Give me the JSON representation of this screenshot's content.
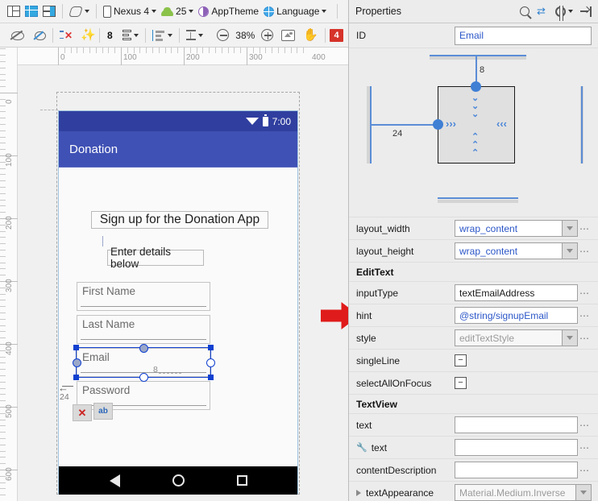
{
  "toolbar_top": {
    "items": [
      {
        "name": "design-view-button",
        "icon": "layout-design-icon",
        "label": ""
      },
      {
        "name": "blueprint-view-button",
        "icon": "blueprint-icon",
        "label": ""
      },
      {
        "name": "design-blueprint-split-button",
        "icon": "design-blueprint-icon",
        "label": ""
      },
      {
        "name": "orientation-button",
        "icon": "orientation-icon",
        "label": "",
        "has_caret": true
      },
      {
        "name": "device-selector",
        "icon": "phone-icon",
        "label": "Nexus 4",
        "has_caret": true
      },
      {
        "name": "api-level-selector",
        "icon": "android-icon",
        "label": "25",
        "has_caret": true
      },
      {
        "name": "theme-selector",
        "icon": "theme-icon",
        "label": "AppTheme",
        "has_caret": false
      },
      {
        "name": "language-selector",
        "icon": "globe-icon",
        "label": "Language",
        "has_caret": true
      }
    ]
  },
  "toolbar_second": {
    "hide_constraints_label": "",
    "show_constraints_label": "",
    "clear_constraints_label": "",
    "infer_constraints_label": "",
    "default_margin": "8",
    "margin_label": "",
    "align_label": "",
    "guideline_label": "",
    "zoom_out_label": "",
    "zoom_level": "38%",
    "zoom_in_label": "",
    "zoom_fit_label": "",
    "pan_label": "",
    "issue_count": "4"
  },
  "canvas": {
    "ruler_h_labels": [
      "0",
      "100",
      "200",
      "300",
      "400"
    ],
    "ruler_v_labels": [
      "0",
      "100",
      "200",
      "300",
      "400",
      "500",
      "600"
    ],
    "constraint_margin_left": "24",
    "constraint_margin_top": "8"
  },
  "phone": {
    "status_time": "7:00",
    "app_title": "Donation",
    "widgets": [
      {
        "name": "title-textview",
        "text": "Sign up for the Donation App"
      },
      {
        "name": "subtitle-textview",
        "text": "Enter details below"
      },
      {
        "name": "first-name-edittext",
        "text": "First Name"
      },
      {
        "name": "last-name-edittext",
        "text": "Last Name"
      },
      {
        "name": "email-edittext",
        "text": "Email"
      },
      {
        "name": "password-edittext",
        "text": "Password"
      }
    ],
    "nav": {
      "back": "",
      "home": "",
      "recents": ""
    }
  },
  "properties": {
    "header_title": "Properties",
    "id_key": "ID",
    "id_value": "Email",
    "rows_layout": [
      {
        "key": "layout_width",
        "value": "wrap_content",
        "style": "blue",
        "dropdown": true,
        "dots": true
      },
      {
        "key": "layout_height",
        "value": "wrap_content",
        "style": "blue",
        "dropdown": true,
        "dots": true
      }
    ],
    "section_edittext": "EditText",
    "rows_edittext": [
      {
        "key": "inputType",
        "value": "textEmailAddress",
        "style": "plain",
        "dropdown": false,
        "dots": true
      },
      {
        "key": "hint",
        "value": "@string/signupEmail",
        "style": "blue",
        "dropdown": false,
        "dots": true
      },
      {
        "key": "style",
        "value": "editTextStyle",
        "style": "dim",
        "dropdown": true,
        "dots": true
      }
    ],
    "checkbox_rows": [
      {
        "key": "singleLine",
        "state": "−"
      },
      {
        "key": "selectAllOnFocus",
        "state": "−"
      }
    ],
    "section_textview": "TextView",
    "rows_textview": [
      {
        "key": "text",
        "value": "",
        "wrench": false,
        "tri": false,
        "dropdown": false,
        "dots": true
      },
      {
        "key": "text",
        "value": "",
        "wrench": true,
        "tri": false,
        "dropdown": false,
        "dots": true
      },
      {
        "key": "contentDescription",
        "value": "",
        "wrench": false,
        "tri": false,
        "dropdown": false,
        "dots": true
      },
      {
        "key": "textAppearance",
        "value": "Material.Medium.Inverse",
        "wrench": false,
        "tri": true,
        "dropdown": true,
        "dots": false
      }
    ]
  },
  "colors": {
    "appbar": "#3F51B5",
    "statusbar": "#303F9F",
    "selection": "#1040D0",
    "annotation_arrow": "#E01B1B",
    "link_blue": "#2B56C8",
    "badge_red": "#D6332A"
  }
}
